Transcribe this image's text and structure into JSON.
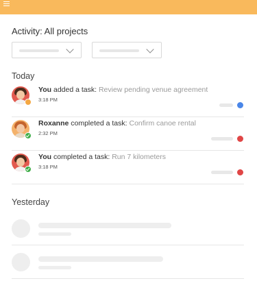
{
  "header": {
    "menu_icon": "hamburger-menu-icon",
    "color": "#f9b95c"
  },
  "page": {
    "title": "Activity: All projects"
  },
  "filters": [
    {
      "name": "project-filter",
      "icon": "chevron-down-icon"
    },
    {
      "name": "user-filter",
      "icon": "chevron-down-icon"
    }
  ],
  "sections": {
    "today": {
      "label": "Today"
    },
    "yesterday": {
      "label": "Yesterday"
    }
  },
  "activities": [
    {
      "actor": "You",
      "action": " added a task: ",
      "task": "Review pending venue agreement",
      "time": "3:18 PM",
      "status": "pending",
      "status_color": "#f4a742",
      "project_color": "#4a86e8"
    },
    {
      "actor": "Roxanne",
      "action": " completed a task: ",
      "task": "Confirm canoe rental",
      "time": "2:32 PM",
      "status": "done",
      "status_color": "#3fae49",
      "project_color": "#e04646"
    },
    {
      "actor": "You",
      "action": " completed a task: ",
      "task": "Run 7 kilometers",
      "time": "3:18 PM",
      "status": "done",
      "status_color": "#3fae49",
      "project_color": "#e04646"
    }
  ]
}
